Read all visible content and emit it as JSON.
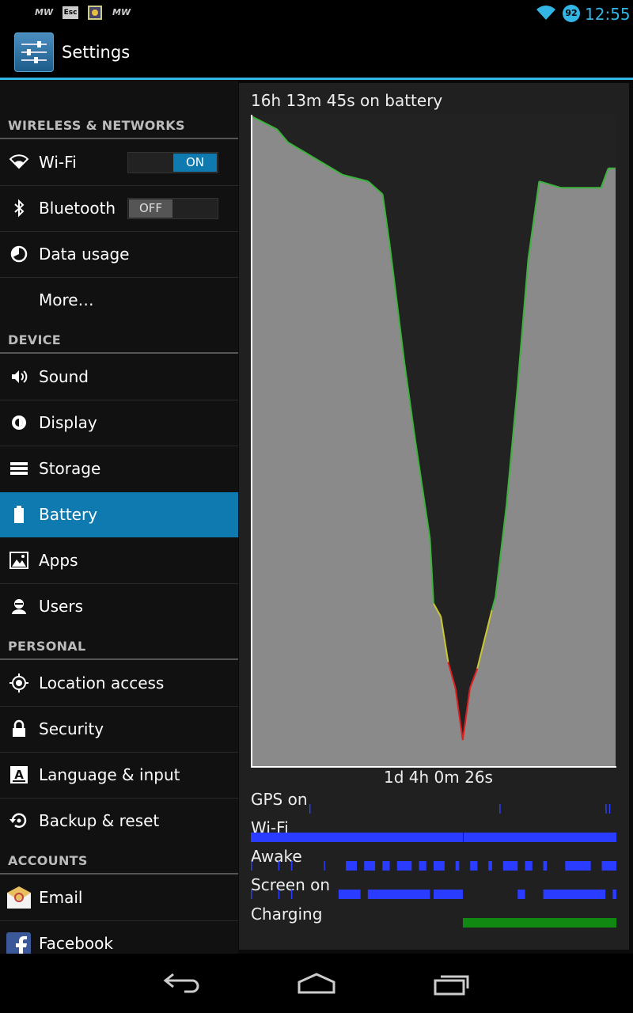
{
  "status_bar": {
    "time": "12:55",
    "battery_level": "92",
    "notification_icons": [
      "mw-icon",
      "esc-icon",
      "app-icon",
      "mw-icon"
    ],
    "notif_text": [
      "MW",
      "Esc",
      "MW"
    ]
  },
  "action_bar": {
    "title": "Settings"
  },
  "categories": {
    "wireless": "WIRELESS & NETWORKS",
    "device": "DEVICE",
    "personal": "PERSONAL",
    "accounts": "ACCOUNTS"
  },
  "items": {
    "wifi": {
      "label": "Wi-Fi",
      "toggle": "ON"
    },
    "bluetooth": {
      "label": "Bluetooth",
      "toggle": "OFF"
    },
    "data_usage": {
      "label": "Data usage"
    },
    "more": {
      "label": "More…"
    },
    "sound": {
      "label": "Sound"
    },
    "display": {
      "label": "Display"
    },
    "storage": {
      "label": "Storage"
    },
    "battery": {
      "label": "Battery"
    },
    "apps": {
      "label": "Apps"
    },
    "users": {
      "label": "Users"
    },
    "location": {
      "label": "Location access"
    },
    "security": {
      "label": "Security"
    },
    "language": {
      "label": "Language & input"
    },
    "backup": {
      "label": "Backup & reset"
    },
    "email": {
      "label": "Email"
    },
    "facebook": {
      "label": "Facebook"
    }
  },
  "battery": {
    "on_battery": "16h 13m 45s on battery",
    "duration": "1d 4h 0m 26s",
    "timeline_labels": {
      "gps": "GPS on",
      "wifi": "Wi-Fi",
      "awake": "Awake",
      "screen": "Screen on",
      "charging": "Charging"
    },
    "colors": {
      "fill": "#8a8a8a",
      "good": "#3cb33c",
      "medium": "#c8c832",
      "low": "#e02020",
      "timeline": "#2a3cff",
      "charging": "#118811"
    }
  },
  "chart_data": {
    "type": "area",
    "x_range": [
      0,
      1
    ],
    "ylim": [
      0,
      100
    ],
    "points": [
      [
        0.0,
        100
      ],
      [
        0.07,
        98
      ],
      [
        0.1,
        96
      ],
      [
        0.25,
        91
      ],
      [
        0.32,
        90
      ],
      [
        0.36,
        88
      ],
      [
        0.38,
        80
      ],
      [
        0.42,
        62
      ],
      [
        0.45,
        50
      ],
      [
        0.49,
        35
      ],
      [
        0.5,
        25
      ],
      [
        0.52,
        23
      ],
      [
        0.54,
        16
      ],
      [
        0.56,
        12
      ],
      [
        0.58,
        4
      ],
      [
        0.6,
        12
      ],
      [
        0.62,
        15
      ],
      [
        0.66,
        24
      ],
      [
        0.67,
        26
      ],
      [
        0.7,
        40
      ],
      [
        0.73,
        58
      ],
      [
        0.76,
        78
      ],
      [
        0.79,
        90
      ],
      [
        0.85,
        89
      ],
      [
        0.91,
        89
      ],
      [
        0.96,
        89
      ],
      [
        0.98,
        92
      ],
      [
        1.0,
        92
      ]
    ],
    "timelines": {
      "gps": [
        [
          0.16,
          0.162
        ],
        [
          0.68,
          0.682
        ],
        [
          0.97,
          0.972
        ],
        [
          0.98,
          0.982
        ]
      ],
      "wifi": [
        [
          0.0,
          0.58
        ],
        [
          0.582,
          1.0
        ]
      ],
      "awake": [
        [
          0.0,
          0.003
        ],
        [
          0.075,
          0.078
        ],
        [
          0.11,
          0.113
        ],
        [
          0.2,
          0.203
        ],
        [
          0.26,
          0.29
        ],
        [
          0.31,
          0.34
        ],
        [
          0.36,
          0.38
        ],
        [
          0.4,
          0.44
        ],
        [
          0.46,
          0.48
        ],
        [
          0.5,
          0.53
        ],
        [
          0.56,
          0.57
        ],
        [
          0.6,
          0.62
        ],
        [
          0.65,
          0.66
        ],
        [
          0.69,
          0.73
        ],
        [
          0.75,
          0.77
        ],
        [
          0.8,
          0.81
        ],
        [
          0.86,
          0.93
        ],
        [
          0.96,
          1.0
        ]
      ],
      "screen": [
        [
          0.0,
          0.003
        ],
        [
          0.075,
          0.078
        ],
        [
          0.11,
          0.113
        ],
        [
          0.24,
          0.3
        ],
        [
          0.32,
          0.49
        ],
        [
          0.5,
          0.58
        ],
        [
          0.73,
          0.75
        ],
        [
          0.8,
          0.97
        ],
        [
          0.99,
          1.0
        ]
      ],
      "charging": [
        [
          0.58,
          1.0
        ]
      ]
    }
  }
}
